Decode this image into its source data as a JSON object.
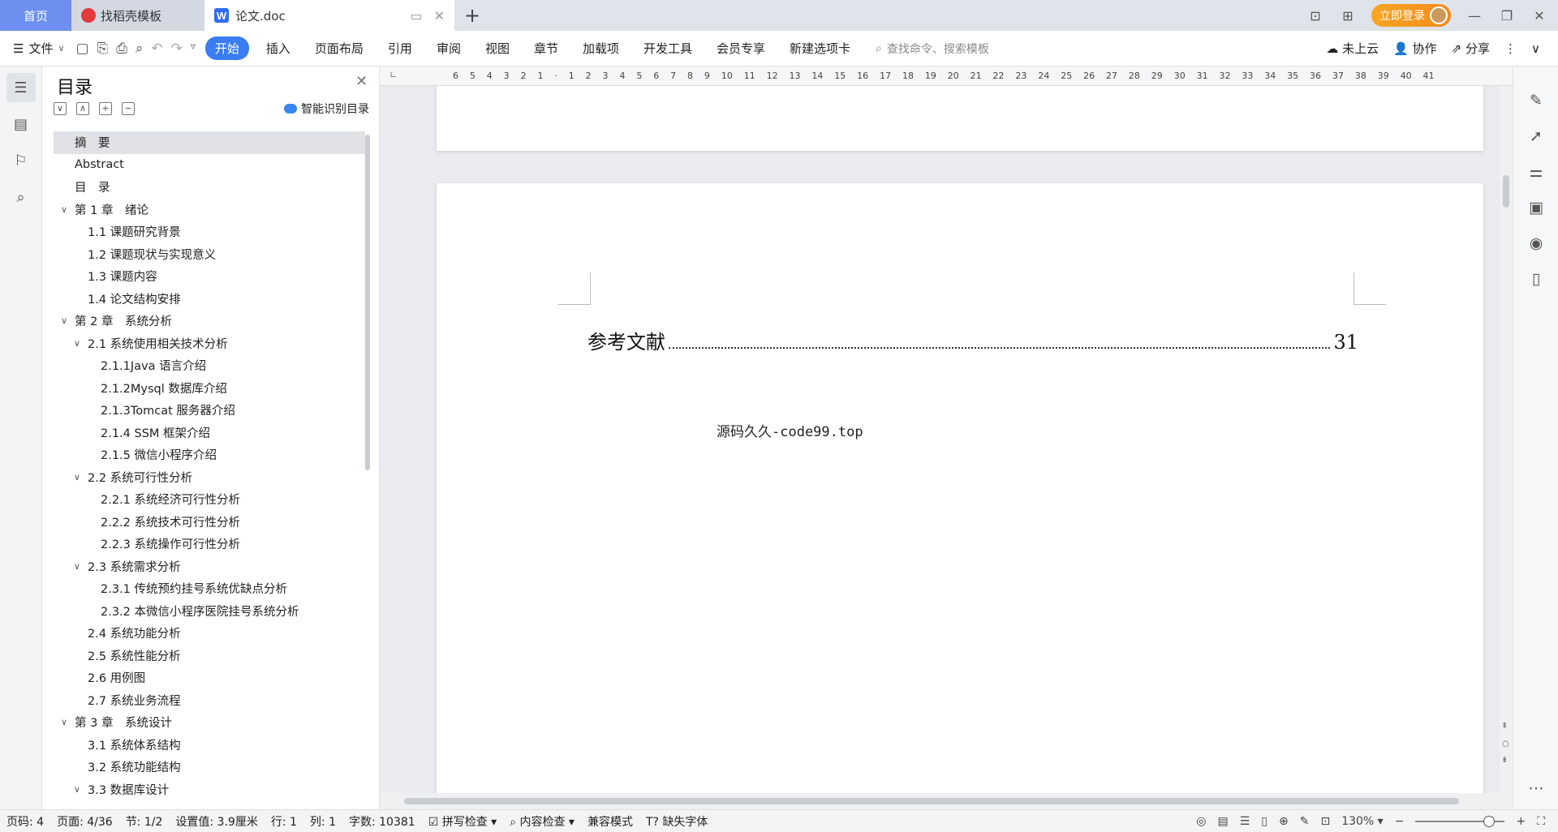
{
  "tabs": {
    "home": "首页",
    "templates": "找稻壳模板",
    "document": "论文.doc",
    "login": "立即登录"
  },
  "ribbon": {
    "file_menu": "文件",
    "tabs": [
      "开始",
      "插入",
      "页面布局",
      "引用",
      "审阅",
      "视图",
      "章节",
      "加载项",
      "开发工具",
      "会员专享",
      "新建选项卡"
    ],
    "search_placeholder": "查找命令、搜索模板",
    "cloud": "未上云",
    "collab": "协作",
    "share": "分享"
  },
  "toc": {
    "title": "目录",
    "smart_button": "智能识别目录",
    "items": [
      {
        "label": "摘　要",
        "level": 1,
        "chevron": false,
        "selected": true
      },
      {
        "label": "Abstract",
        "level": 1,
        "chevron": false
      },
      {
        "label": "目　录",
        "level": 1,
        "chevron": false
      },
      {
        "label": "第 1 章　绪论",
        "level": 1,
        "chevron": true
      },
      {
        "label": "1.1 课题研究背景",
        "level": 2,
        "chevron": false
      },
      {
        "label": "1.2 课题现状与实现意义",
        "level": 2,
        "chevron": false
      },
      {
        "label": "1.3 课题内容",
        "level": 2,
        "chevron": false
      },
      {
        "label": "1.4 论文结构安排",
        "level": 2,
        "chevron": false
      },
      {
        "label": "第 2 章　系统分析",
        "level": 1,
        "chevron": true
      },
      {
        "label": "2.1 系统使用相关技术分析",
        "level": 2,
        "chevron": true
      },
      {
        "label": "2.1.1Java 语言介绍",
        "level": 3,
        "chevron": false
      },
      {
        "label": "2.1.2Mysql 数据库介绍",
        "level": 3,
        "chevron": false
      },
      {
        "label": "2.1.3Tomcat 服务器介绍",
        "level": 3,
        "chevron": false
      },
      {
        "label": "2.1.4 SSM 框架介绍",
        "level": 3,
        "chevron": false
      },
      {
        "label": "2.1.5 微信小程序介绍",
        "level": 3,
        "chevron": false
      },
      {
        "label": "2.2 系统可行性分析",
        "level": 2,
        "chevron": true
      },
      {
        "label": "2.2.1 系统经济可行性分析",
        "level": 3,
        "chevron": false
      },
      {
        "label": "2.2.2 系统技术可行性分析",
        "level": 3,
        "chevron": false
      },
      {
        "label": "2.2.3 系统操作可行性分析",
        "level": 3,
        "chevron": false
      },
      {
        "label": "2.3 系统需求分析",
        "level": 2,
        "chevron": true
      },
      {
        "label": "2.3.1 传统预约挂号系统优缺点分析",
        "level": 3,
        "chevron": false
      },
      {
        "label": "2.3.2 本微信小程序医院挂号系统分析",
        "level": 3,
        "chevron": false
      },
      {
        "label": "2.4 系统功能分析",
        "level": 2,
        "chevron": false
      },
      {
        "label": "2.5 系统性能分析",
        "level": 2,
        "chevron": false
      },
      {
        "label": "2.6 用例图",
        "level": 2,
        "chevron": false
      },
      {
        "label": "2.7 系统业务流程",
        "level": 2,
        "chevron": false
      },
      {
        "label": "第 3 章　系统设计",
        "level": 1,
        "chevron": true
      },
      {
        "label": "3.1 系统体系结构",
        "level": 2,
        "chevron": false
      },
      {
        "label": "3.2 系统功能结构",
        "level": 2,
        "chevron": false
      },
      {
        "label": "3.3 数据库设计",
        "level": 2,
        "chevron": true
      }
    ]
  },
  "ruler": {
    "numbers": "6 5 4 3 2 1 · 1 2 3 4 5 6 7 8 9 10 11 12 13 14 15 16 17 18 19 20 21 22 23 24 25 26 27 28 29 30 31 32 33 34 35 36 37 38 39 40 41"
  },
  "document": {
    "toc_entry_title": "参考文献",
    "toc_entry_page": "31",
    "watermark": "源码久久-code99.top"
  },
  "status": {
    "page_code": "页码: 4",
    "page": "页面: 4/36",
    "section": "节: 1/2",
    "setting": "设置值: 3.9厘米",
    "row": "行: 1",
    "col": "列: 1",
    "words": "字数: 10381",
    "spell": "拼写检查",
    "content_check": "内容检查",
    "compat": "兼容模式",
    "missing_font": "缺失字体",
    "zoom": "130%"
  }
}
